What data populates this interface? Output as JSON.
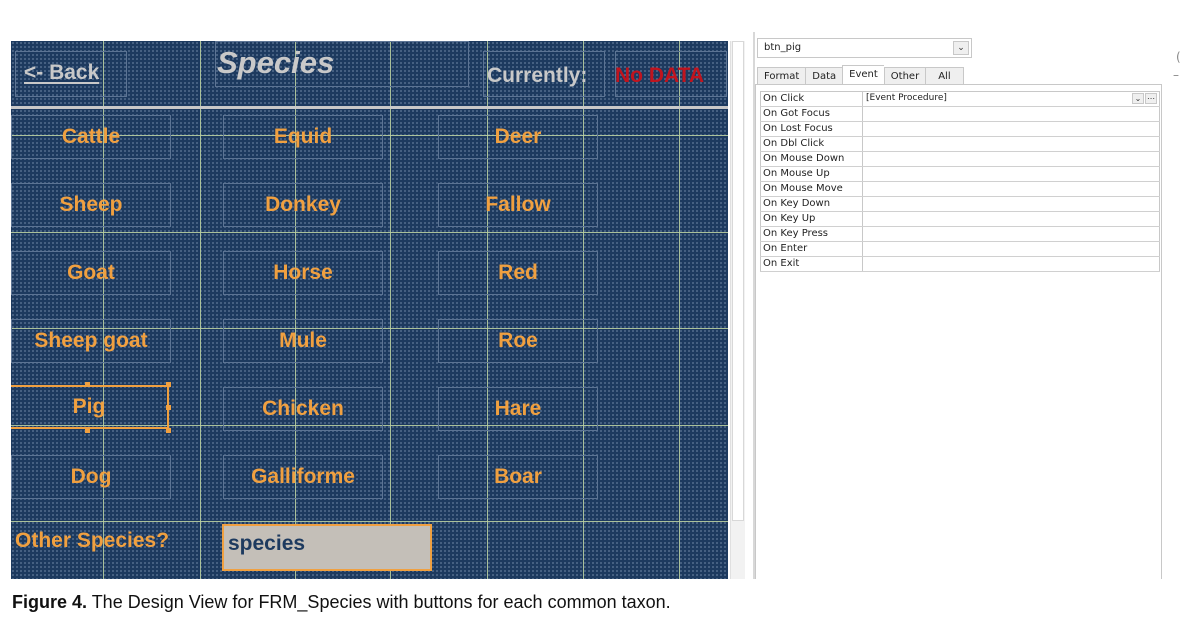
{
  "form": {
    "back_label": "<- Back",
    "title": "Species",
    "currently_label": "Currently:",
    "status_value": "No DATA",
    "species_buttons": [
      [
        "Cattle",
        "Equid",
        "Deer"
      ],
      [
        "Sheep",
        "Donkey",
        "Fallow"
      ],
      [
        "Goat",
        "Horse",
        "Red"
      ],
      [
        "Sheep goat",
        "Mule",
        "Roe"
      ],
      [
        "Pig",
        "Chicken",
        "Hare"
      ],
      [
        "Dog",
        "Galliforme",
        "Boar"
      ]
    ],
    "selected_button": "Pig",
    "other_species_label": "Other Species?",
    "other_species_value": "species"
  },
  "property_sheet": {
    "selected_object": "btn_pig",
    "tabs": [
      "Format",
      "Data",
      "Event",
      "Other",
      "All"
    ],
    "active_tab": "Event",
    "properties": [
      {
        "name": "On Click",
        "value": "[Event Procedure]"
      },
      {
        "name": "On Got Focus",
        "value": ""
      },
      {
        "name": "On Lost Focus",
        "value": ""
      },
      {
        "name": "On Dbl Click",
        "value": ""
      },
      {
        "name": "On Mouse Down",
        "value": ""
      },
      {
        "name": "On Mouse Up",
        "value": ""
      },
      {
        "name": "On Mouse Move",
        "value": ""
      },
      {
        "name": "On Key Down",
        "value": ""
      },
      {
        "name": "On Key Up",
        "value": ""
      },
      {
        "name": "On Key Press",
        "value": ""
      },
      {
        "name": "On Enter",
        "value": ""
      },
      {
        "name": "On Exit",
        "value": ""
      }
    ]
  },
  "caption": {
    "label": "Figure 4.",
    "text": " The Design View for FRM_Species with buttons for each common taxon."
  },
  "colors": {
    "canvas_bg": "#1d3a5f",
    "button_text": "#f0a040",
    "status_red": "#c0141e",
    "header_text": "#c9c9c9"
  }
}
